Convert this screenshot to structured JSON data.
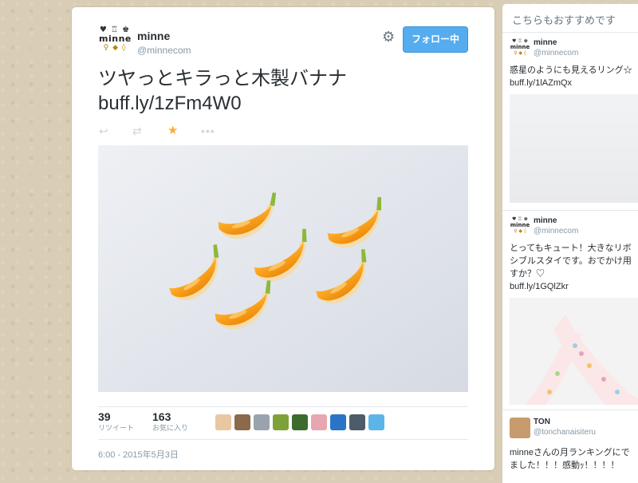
{
  "tweet": {
    "user_name": "minne",
    "user_handle": "@minnecom",
    "logo": {
      "row1": "♥ ♖ ♚",
      "row2": "minne",
      "row3": "♀ ◆ ◊"
    },
    "follow_label": "フォロー中",
    "text_line1": "ツヤっとキラっと木製バナナ",
    "text_line2": "buff.ly/1zFm4W0",
    "retweets": "39",
    "retweets_label": "リツイート",
    "favorites": "163",
    "favorites_label": "お気に入り",
    "timestamp": "6:00 - 2015年5月3日",
    "favorited": true,
    "icons": {
      "reply": "reply-icon",
      "retweet": "retweet-icon",
      "favorite": "star-icon",
      "more": "more-icon",
      "settings": "gear-icon"
    },
    "colors": {
      "accent": "#55acee",
      "favorite": "#ffac33",
      "banana": "#f4a11a"
    }
  },
  "sidebar": {
    "title": "こちらもおすすめです",
    "items": [
      {
        "name": "minne",
        "handle": "@minnecom",
        "text_lines": [
          "惑星のようにも見えるリング☆",
          "buff.ly/1lAZmQx"
        ]
      },
      {
        "name": "minne",
        "handle": "@minnecom",
        "text_lines": [
          "とってもキュート！大きなリボ",
          "シブルスタイです。おでかけ用",
          "すか？♡",
          "buff.ly/1GQlZkr"
        ]
      },
      {
        "name": "TON",
        "handle": "@tonchanaisiteru",
        "text_lines": [
          "minneさんの月ランキングにで",
          "ました！！！感動ｯ！！！！"
        ]
      }
    ]
  }
}
